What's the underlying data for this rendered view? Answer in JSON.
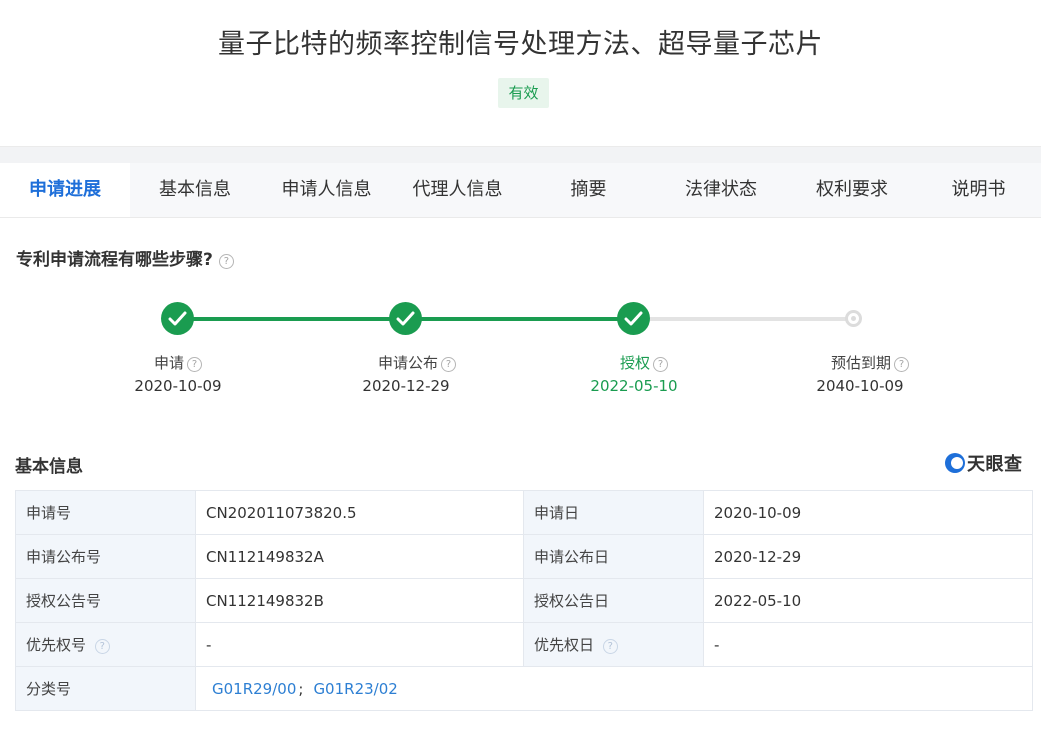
{
  "header": {
    "title": "量子比特的频率控制信号处理方法、超导量子芯片",
    "status_badge": "有效"
  },
  "tabs": [
    {
      "label": "申请进展",
      "active": true
    },
    {
      "label": "基本信息"
    },
    {
      "label": "申请人信息"
    },
    {
      "label": "代理人信息"
    },
    {
      "label": "摘要"
    },
    {
      "label": "法律状态"
    },
    {
      "label": "权利要求"
    },
    {
      "label": "说明书"
    }
  ],
  "progress": {
    "question": "专利申请流程有哪些步骤?",
    "help_icon_text": "?",
    "steps": [
      {
        "label": "申请",
        "date": "2020-10-09",
        "state": "done"
      },
      {
        "label": "申请公布",
        "date": "2020-12-29",
        "state": "done"
      },
      {
        "label": "授权",
        "date": "2022-05-10",
        "state": "current"
      },
      {
        "label": "预估到期",
        "date": "2040-10-09",
        "state": "pending"
      }
    ],
    "colors": {
      "done": "#1a9c50",
      "pending": "#dcdcdc"
    }
  },
  "basic_info": {
    "heading": "基本信息",
    "brand": "天眼查",
    "rows": [
      {
        "k1": "申请号",
        "v1": "CN202011073820.5",
        "k2": "申请日",
        "v2": "2020-10-09"
      },
      {
        "k1": "申请公布号",
        "v1": "CN112149832A",
        "k2": "申请公布日",
        "v2": "2020-12-29"
      },
      {
        "k1": "授权公告号",
        "v1": "CN112149832B",
        "k2": "授权公告日",
        "v2": "2022-05-10"
      },
      {
        "k1": "优先权号",
        "v1": "-",
        "k2": "优先权日",
        "v2": "-"
      }
    ],
    "classification": {
      "label": "分类号",
      "codes": [
        "G01R29/00",
        "G01R23/02"
      ],
      "separator": ";"
    }
  },
  "colors": {
    "accent": "#1e6fd9",
    "link": "#2d7fd3",
    "success": "#1a9c50"
  }
}
